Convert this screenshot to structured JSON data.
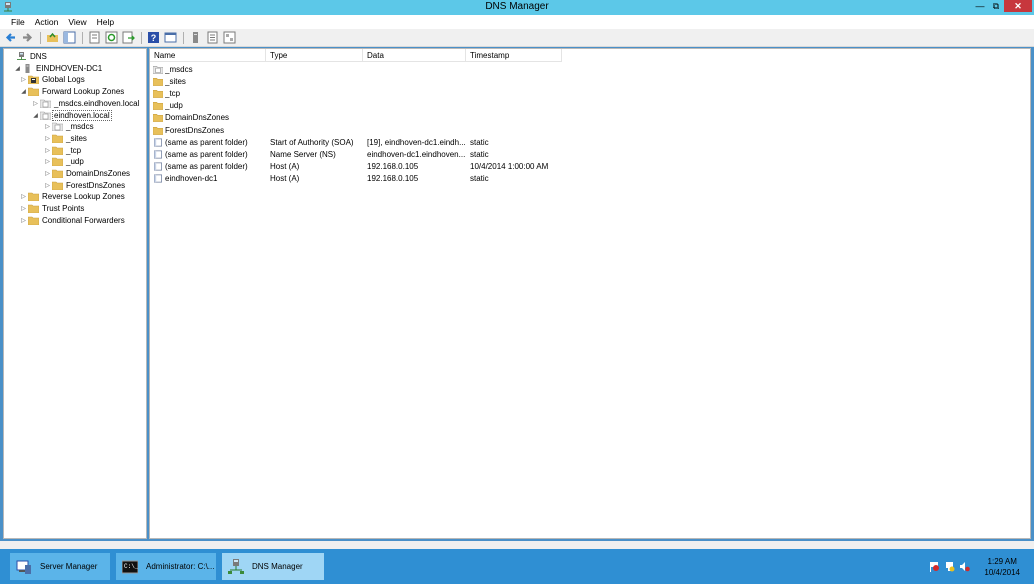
{
  "window": {
    "title": "DNS Manager",
    "minimize": "—",
    "restore": "⧉",
    "close": "✕"
  },
  "menu": [
    "File",
    "Action",
    "View",
    "Help"
  ],
  "toolbar": [
    "back-icon",
    "forward-icon",
    "up-folder-icon",
    "show-tree-icon",
    "properties-icon",
    "refresh-icon",
    "export-icon",
    "help-icon",
    "console-icon",
    "server-icon",
    "list-icon",
    "details-icon"
  ],
  "tree": [
    {
      "label": "DNS",
      "icon": "dns-icon",
      "expander": ""
    },
    {
      "label": "EINDHOVEN-DC1",
      "icon": "server-icon",
      "expander": "◢"
    },
    {
      "label": "Global Logs",
      "icon": "log-icon",
      "expander": "▷"
    },
    {
      "label": "Forward Lookup Zones",
      "icon": "folder-icon",
      "expander": "◢"
    },
    {
      "label": "_msdcs.eindhoven.local",
      "icon": "zone-icon",
      "expander": "▷"
    },
    {
      "label": "eindhoven.local",
      "icon": "zone-icon",
      "expander": "◢"
    },
    {
      "label": "_msdcs",
      "icon": "zone-icon",
      "expander": "▷"
    },
    {
      "label": "_sites",
      "icon": "folder-icon",
      "expander": "▷"
    },
    {
      "label": "_tcp",
      "icon": "folder-icon",
      "expander": "▷"
    },
    {
      "label": "_udp",
      "icon": "folder-icon",
      "expander": "▷"
    },
    {
      "label": "DomainDnsZones",
      "icon": "folder-icon",
      "expander": "▷"
    },
    {
      "label": "ForestDnsZones",
      "icon": "folder-icon",
      "expander": "▷"
    },
    {
      "label": "Reverse Lookup Zones",
      "icon": "folder-icon",
      "expander": "▷"
    },
    {
      "label": "Trust Points",
      "icon": "folder-icon",
      "expander": "▷"
    },
    {
      "label": "Conditional Forwarders",
      "icon": "folder-icon",
      "expander": "▷"
    }
  ],
  "columns": [
    "Name",
    "Type",
    "Data",
    "Timestamp"
  ],
  "rows": [
    {
      "name": "_msdcs",
      "type": "",
      "data": "",
      "timestamp": "",
      "icon": "zone-icon"
    },
    {
      "name": "_sites",
      "type": "",
      "data": "",
      "timestamp": "",
      "icon": "folder-icon"
    },
    {
      "name": "_tcp",
      "type": "",
      "data": "",
      "timestamp": "",
      "icon": "folder-icon"
    },
    {
      "name": "_udp",
      "type": "",
      "data": "",
      "timestamp": "",
      "icon": "folder-icon"
    },
    {
      "name": "DomainDnsZones",
      "type": "",
      "data": "",
      "timestamp": "",
      "icon": "folder-icon"
    },
    {
      "name": "ForestDnsZones",
      "type": "",
      "data": "",
      "timestamp": "",
      "icon": "folder-icon"
    },
    {
      "name": "(same as parent folder)",
      "type": "Start of Authority (SOA)",
      "data": "[19], eindhoven-dc1.eindh...",
      "timestamp": "static",
      "icon": "record-icon"
    },
    {
      "name": "(same as parent folder)",
      "type": "Name Server (NS)",
      "data": "eindhoven-dc1.eindhoven...",
      "timestamp": "static",
      "icon": "record-icon"
    },
    {
      "name": "(same as parent folder)",
      "type": "Host (A)",
      "data": "192.168.0.105",
      "timestamp": "10/4/2014 1:00:00 AM",
      "icon": "record-icon"
    },
    {
      "name": "eindhoven-dc1",
      "type": "Host (A)",
      "data": "192.168.0.105",
      "timestamp": "static",
      "icon": "record-icon"
    }
  ],
  "taskbar": [
    {
      "label": "Server Manager",
      "icon": "server-manager-icon"
    },
    {
      "label": "Administrator: C:\\...",
      "icon": "cmd-icon"
    },
    {
      "label": "DNS Manager",
      "icon": "dns-manager-icon"
    }
  ],
  "tray": [
    "flag-icon",
    "network-icon",
    "volume-icon"
  ],
  "clock": {
    "time": "1:29 AM",
    "date": "10/4/2014"
  }
}
